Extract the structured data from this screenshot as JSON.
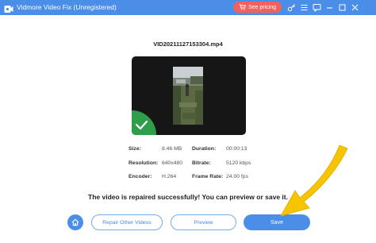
{
  "window": {
    "title": "Vidmore Video Fix (Unregistered)",
    "accent_color": "#4a8ee8",
    "pricing_button_label": "See pricing",
    "pricing_button_color": "#f0625b",
    "titlebar_icons": [
      "key-icon",
      "menu-icon",
      "feedback-icon",
      "minimize-icon",
      "maximize-icon",
      "close-icon"
    ]
  },
  "video": {
    "file_name": "VID20211127153304.mp4"
  },
  "info": {
    "size_label": "Size:",
    "size_value": "8.46 MB",
    "duration_label": "Duration:",
    "duration_value": "00:00:13",
    "resolution_label": "Resolution:",
    "resolution_value": "640x480",
    "bitrate_label": "Bitrate:",
    "bitrate_value": "5120 kbps",
    "encoder_label": "Encoder:",
    "encoder_value": "H.264",
    "framerate_label": "Frame Rate:",
    "framerate_value": "24.00 fps"
  },
  "status": {
    "message": "The video is repaired successfully! You can preview or save it.",
    "badge_color": "#2e9e4a"
  },
  "actions": {
    "repair_other_label": "Repair Other Videos",
    "preview_label": "Preview",
    "save_label": "Save"
  },
  "annotation": {
    "arrow_color": "#f6c400"
  }
}
